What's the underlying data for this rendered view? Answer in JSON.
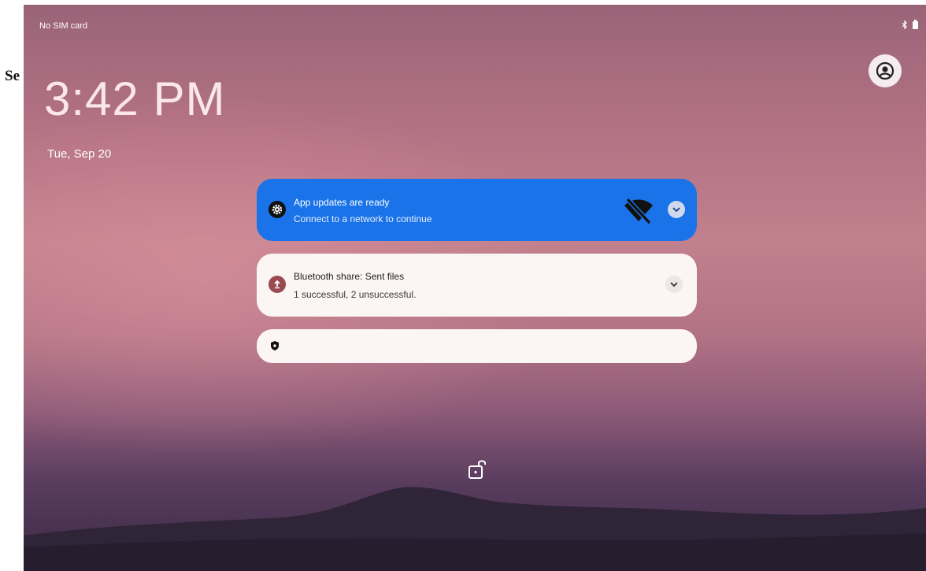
{
  "page_stub_text": "Se",
  "status_bar": {
    "carrier": "No SIM card",
    "icons": [
      "bluetooth-icon",
      "battery-icon"
    ]
  },
  "lockscreen": {
    "time": "3:42 PM",
    "date": "Tue, Sep 20"
  },
  "notifications": [
    {
      "title": "App updates are ready",
      "text": "Connect to a network to continue",
      "icon": "settings-gear-icon",
      "trailing_icon": "wifi-off-icon",
      "color": "#1a73e8"
    },
    {
      "title": "Bluetooth share: Sent files",
      "text": "1 successful, 2 unsuccessful.",
      "icon": "upload-icon",
      "color": "#9a4a50"
    },
    {
      "title": "",
      "text": "",
      "icon": "shield-icon"
    }
  ],
  "colors": {
    "accent_blue": "#1a73e8",
    "card_bg": "#fbf5f3"
  }
}
